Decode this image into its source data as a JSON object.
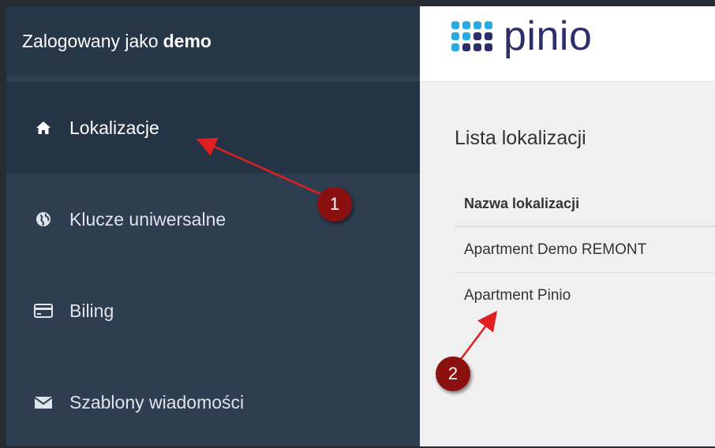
{
  "sidebar": {
    "header": {
      "prefix": "Zalogowany jako",
      "username": "demo"
    },
    "items": [
      {
        "label": "Lokalizacje",
        "icon": "home-icon",
        "active": true
      },
      {
        "label": "Klucze uniwersalne",
        "icon": "globe-icon",
        "active": false
      },
      {
        "label": "Biling",
        "icon": "credit-card-icon",
        "active": false
      },
      {
        "label": "Szablony wiadomości",
        "icon": "envelope-icon",
        "active": false
      }
    ]
  },
  "brand": {
    "logo_text": "pinio",
    "logo_colors": [
      "#29abe2",
      "#2d2f6b"
    ]
  },
  "main": {
    "list_title": "Lista lokalizacji",
    "table": {
      "column_header": "Nazwa lokalizacji",
      "rows": [
        "Apartment Demo REMONT",
        "Apartment Pinio"
      ]
    }
  },
  "annotations": {
    "badges": [
      "1",
      "2"
    ],
    "arrow_color": "#e02020",
    "badge_color": "#8b1111"
  }
}
